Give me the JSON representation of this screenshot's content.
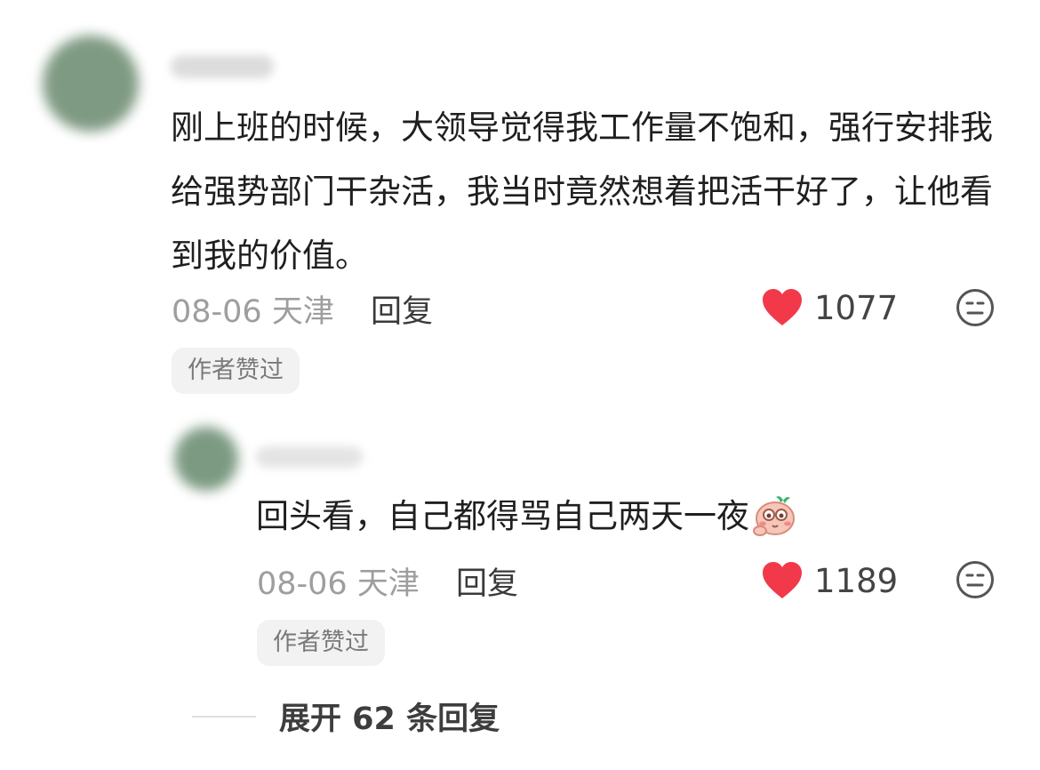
{
  "comment": {
    "text": "刚上班的时候，大领导觉得我工作量不饱和，强行安排我给强势部门干杂活，我当时竟然想着把活干好了，让他看到我的价值。",
    "date": "08-06",
    "location": "天津",
    "reply_label": "回复",
    "likes": "1077",
    "badge": "作者赞过",
    "heart_color": "#f2394a"
  },
  "reply": {
    "text": "回头看，自己都得骂自己两天一夜",
    "date": "08-06",
    "location": "天津",
    "reply_label": "回复",
    "likes": "1189",
    "badge": "作者赞过"
  },
  "expand_replies": "展开 62 条回复"
}
